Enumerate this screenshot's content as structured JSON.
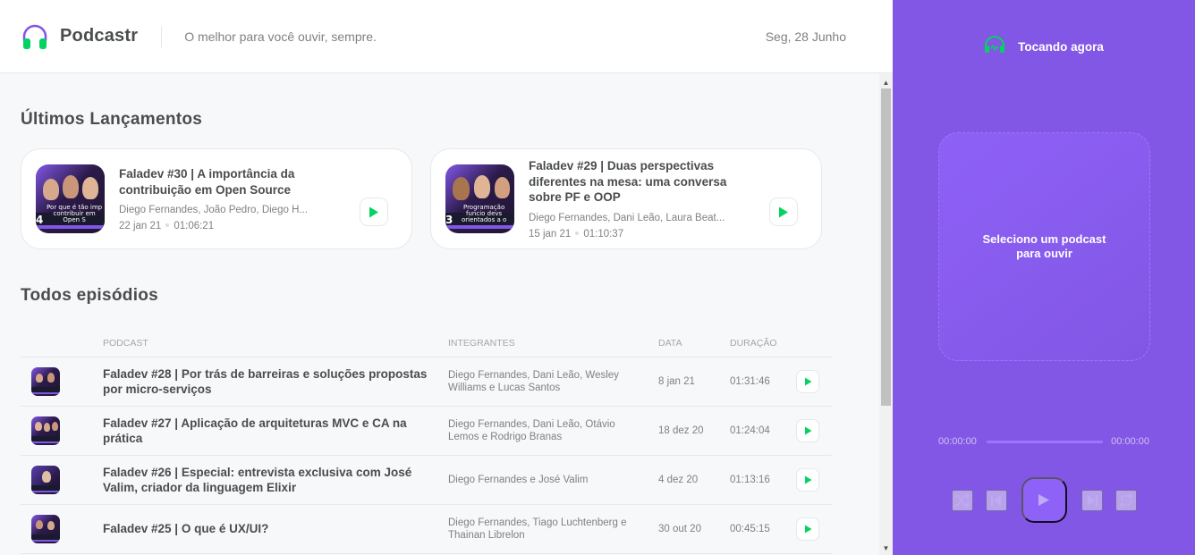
{
  "colors": {
    "brand": "#8257e5",
    "green": "#04d361",
    "text": "#494d4b",
    "muted": "#808080"
  },
  "header": {
    "app_name": "Podcastr",
    "tagline": "O melhor para você ouvir, sempre.",
    "date": "Seg, 28 Junho",
    "logo_icon": "headphones-icon"
  },
  "latest": {
    "heading": "Últimos Lançamentos",
    "episodes": [
      {
        "title": "Faladev #30 | A importância da contribuição em Open Source",
        "members": "Diego Fernandes, João Pedro, Diego H...",
        "date": "22 jan 21",
        "duration": "01:06:21",
        "thumb_number": "4",
        "thumb_caption": "Por que é tão imp contribuir em Open S"
      },
      {
        "title": "Faladev #29 | Duas perspectivas diferentes na mesa: uma conversa sobre PF e OOP",
        "members": "Diego Fernandes, Dani Leão, Laura Beat...",
        "date": "15 jan 21",
        "duration": "01:10:37",
        "thumb_number": "3",
        "thumb_caption": "Programação funcio devs orientados a o"
      }
    ]
  },
  "all": {
    "heading": "Todos episódios",
    "columns": {
      "podcast": "Podcast",
      "members": "Integrantes",
      "date": "Data",
      "duration": "Duração"
    },
    "episodes": [
      {
        "title": "Faladev #28 | Por trás de barreiras e soluções propostas por micro-serviços",
        "members": "Diego Fernandes, Dani Leão, Wesley Williams e Lucas Santos",
        "date": "8 jan 21",
        "duration": "01:31:46"
      },
      {
        "title": "Faladev #27 | Aplicação de arquiteturas MVC e CA na prática",
        "members": "Diego Fernandes, Dani Leão, Otávio Lemos e Rodrigo Branas",
        "date": "18 dez 20",
        "duration": "01:24:04"
      },
      {
        "title": "Faladev #26 | Especial: entrevista exclusiva com José Valim, criador da linguagem Elixir",
        "members": "Diego Fernandes e José Valim",
        "date": "4 dez 20",
        "duration": "01:13:16"
      },
      {
        "title": "Faladev #25 | O que é UX/UI?",
        "members": "Diego Fernandes, Tiago Luchtenberg e Thainan Librelon",
        "date": "30 out 20",
        "duration": "00:45:15"
      }
    ]
  },
  "player": {
    "heading": "Tocando agora",
    "empty_text": "Seleciono um podcast para ouvir",
    "current_time": "00:00:00",
    "total_time": "00:00:00",
    "progress": 0
  }
}
